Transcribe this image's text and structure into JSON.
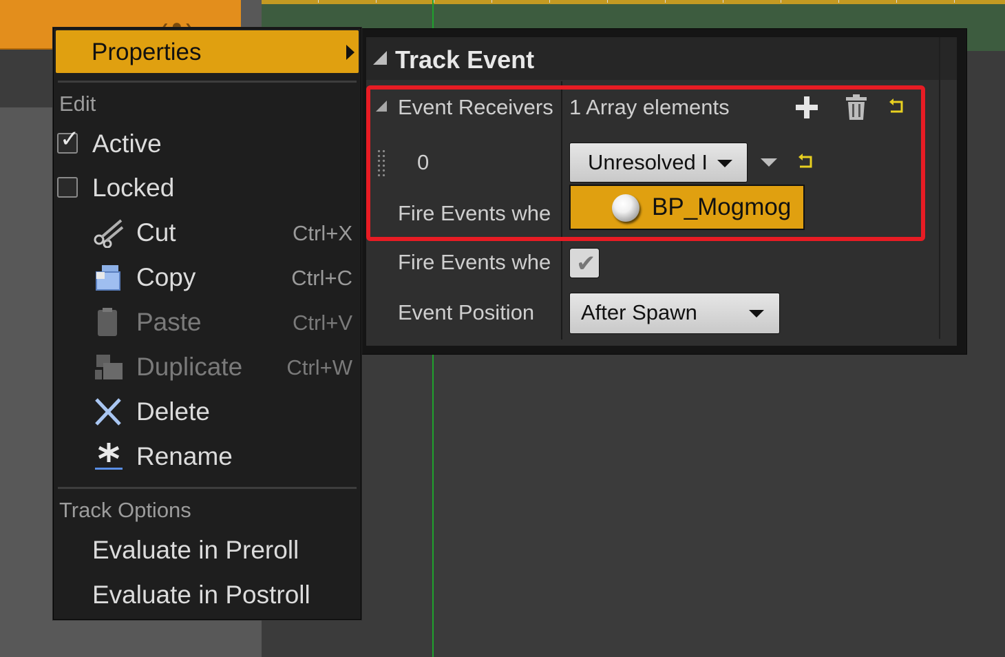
{
  "menu": {
    "properties_label": "Properties",
    "edit_header": "Edit",
    "active_label": "Active",
    "active_checked": true,
    "locked_label": "Locked",
    "locked_checked": false,
    "items": [
      {
        "label": "Cut",
        "shortcut": "Ctrl+X",
        "icon": "scissors-icon",
        "enabled": true
      },
      {
        "label": "Copy",
        "shortcut": "Ctrl+C",
        "icon": "copy-icon",
        "enabled": true
      },
      {
        "label": "Paste",
        "shortcut": "Ctrl+V",
        "icon": "paste-icon",
        "enabled": false
      },
      {
        "label": "Duplicate",
        "shortcut": "Ctrl+W",
        "icon": "duplicate-icon",
        "enabled": false
      },
      {
        "label": "Delete",
        "shortcut": "",
        "icon": "delete-x-icon",
        "enabled": true
      },
      {
        "label": "Rename",
        "shortcut": "",
        "icon": "rename-icon",
        "enabled": true
      }
    ],
    "track_options_header": "Track Options",
    "preroll_label": "Evaluate in Preroll",
    "postroll_label": "Evaluate in Postroll"
  },
  "details": {
    "section_title": "Track Event",
    "event_receivers_label": "Event Receivers",
    "array_count_text": "1 Array elements",
    "element_index": "0",
    "element_value": "Unresolved I",
    "actor_name": "BP_Mogmog",
    "fire_events_label_1": "Fire Events whe",
    "fire_events_label_2": "Fire Events whe",
    "fire_events_checked": true,
    "event_position_label": "Event Position",
    "event_position_value": "After Spawn"
  },
  "colors": {
    "accent": "#e0a010",
    "highlight": "#e81c24",
    "playhead": "#1fa22c",
    "track_bar": "#e38e1c"
  }
}
